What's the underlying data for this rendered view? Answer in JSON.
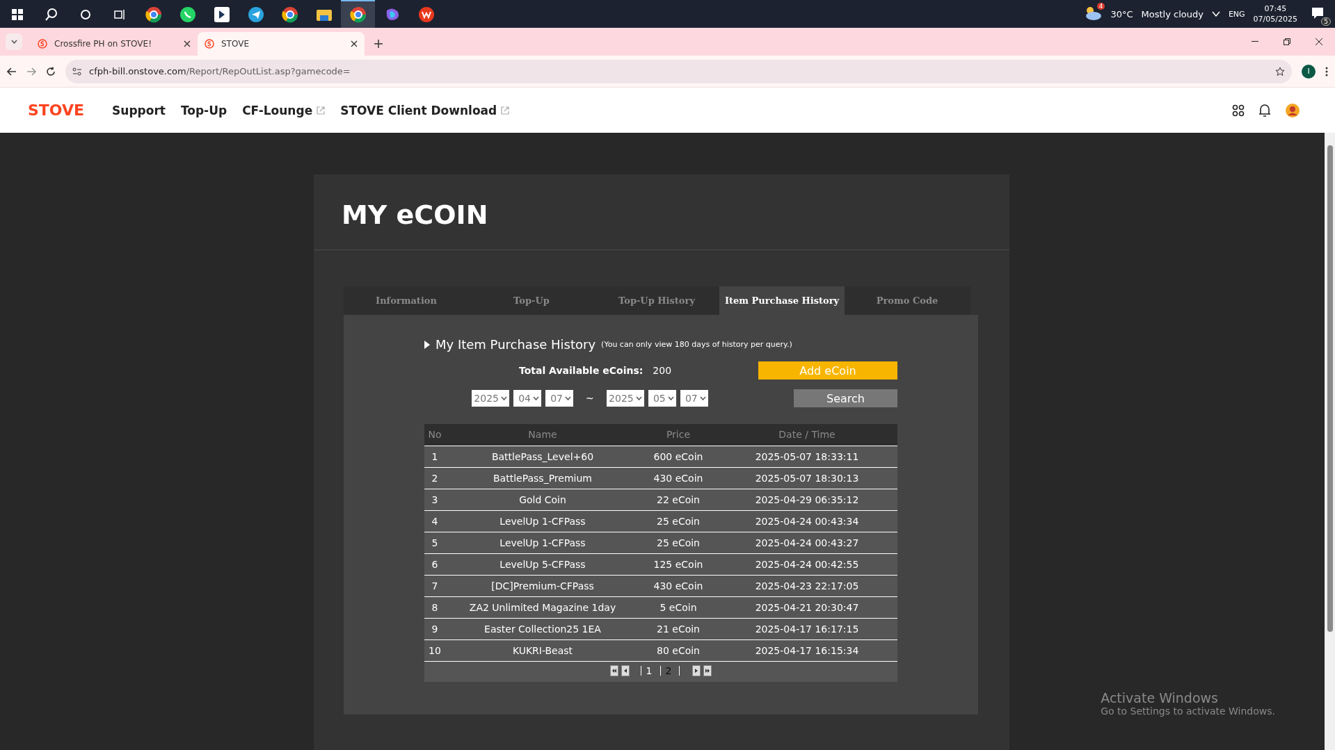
{
  "taskbar": {
    "apps": [
      {
        "kind": "browser",
        "active": false
      },
      {
        "kind": "chat",
        "active": false
      },
      {
        "kind": "square",
        "active": false
      },
      {
        "kind": "plane",
        "active": false
      },
      {
        "kind": "browser",
        "active": false
      },
      {
        "kind": "folder",
        "active": false
      },
      {
        "kind": "browser",
        "active": true
      },
      {
        "kind": "swirl",
        "active": false
      },
      {
        "kind": "office",
        "active": false
      }
    ],
    "weather": {
      "badge": "4",
      "temperature": "30°C",
      "condition": "Mostly cloudy"
    },
    "language": "ENG",
    "time": "07:45",
    "date": "07/05/2025",
    "notifications": "5"
  },
  "browser": {
    "tabs": [
      {
        "title": "Crossfire PH on STOVE!",
        "selected": false
      },
      {
        "title": "STOVE",
        "selected": true
      }
    ],
    "url": {
      "host": "cfph-bill.onstove.com",
      "path": "/Report/RepOutList.asp?gamecode="
    },
    "profile": "I"
  },
  "site_nav": {
    "logo": "STOVE",
    "links": [
      {
        "label": "Support",
        "external": false
      },
      {
        "label": "Top-Up",
        "external": false
      },
      {
        "label": "CF-Lounge",
        "external": true
      },
      {
        "label": "STOVE Client Download",
        "external": true
      }
    ]
  },
  "page": {
    "title": "MY eCOIN",
    "tabs": [
      {
        "label": "Information",
        "selected": false
      },
      {
        "label": "Top-Up",
        "selected": false
      },
      {
        "label": "Top-Up History",
        "selected": false
      },
      {
        "label": "Item Purchase History",
        "selected": true
      },
      {
        "label": "Promo Code",
        "selected": false
      }
    ],
    "section": {
      "heading": "My Item Purchase History",
      "note": "(You can only view 180 days of history per query.)"
    },
    "balance": {
      "label": "Total Available eCoins:",
      "value": "200"
    },
    "add_button": "Add eCoin",
    "date_from": [
      "2025",
      "04",
      "07"
    ],
    "separator": "~",
    "date_to": [
      "2025",
      "05",
      "07"
    ],
    "search_button": "Search",
    "table": {
      "columns": [
        "No",
        "Name",
        "Price",
        "Date / Time"
      ],
      "rows": [
        [
          "1",
          "BattlePass_Level+60",
          "600 eCoin",
          "2025-05-07 18:33:11"
        ],
        [
          "2",
          "BattlePass_Premium",
          "430 eCoin",
          "2025-05-07 18:30:13"
        ],
        [
          "3",
          "Gold Coin",
          "22 eCoin",
          "2025-04-29 06:35:12"
        ],
        [
          "4",
          "LevelUp 1-CFPass",
          "25 eCoin",
          "2025-04-24 00:43:34"
        ],
        [
          "5",
          "LevelUp 1-CFPass",
          "25 eCoin",
          "2025-04-24 00:43:27"
        ],
        [
          "6",
          "LevelUp 5-CFPass",
          "125 eCoin",
          "2025-04-24 00:42:55"
        ],
        [
          "7",
          "[DC]Premium-CFPass",
          "430 eCoin",
          "2025-04-23 22:17:05"
        ],
        [
          "8",
          "ZA2 Unlimited Magazine 1day",
          "5 eCoin",
          "2025-04-21 20:30:47"
        ],
        [
          "9",
          "Easter Collection25 1EA",
          "21 eCoin",
          "2025-04-17 16:17:15"
        ],
        [
          "10",
          "KUKRI-Beast",
          "80 eCoin",
          "2025-04-17 16:15:34"
        ]
      ]
    },
    "pagination": [
      {
        "label": "1",
        "selected": true
      },
      {
        "label": "2",
        "selected": false
      }
    ]
  },
  "activation_notice": {
    "title": "Activate Windows",
    "text": "Go to Settings to activate Windows."
  }
}
